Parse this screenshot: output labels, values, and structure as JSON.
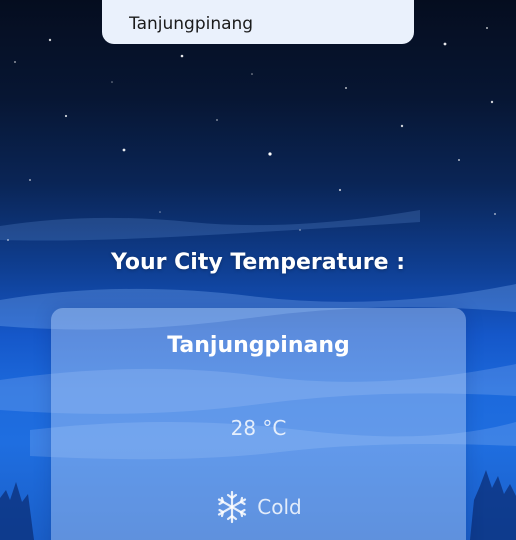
{
  "search": {
    "value": "Tanjungpinang"
  },
  "heading": "Your City Temperature :",
  "weather": {
    "city": "Tanjungpinang",
    "temperature": "28",
    "unit": "°C",
    "condition": "Cold",
    "condition_icon": "snowflake-icon"
  },
  "colors": {
    "sky_top": "#050d1f",
    "sky_bottom": "#1f6ee0",
    "search_bg": "#eaf1fc",
    "card_bg": "rgba(190,215,250,0.42)",
    "text_light": "#ffffff"
  }
}
